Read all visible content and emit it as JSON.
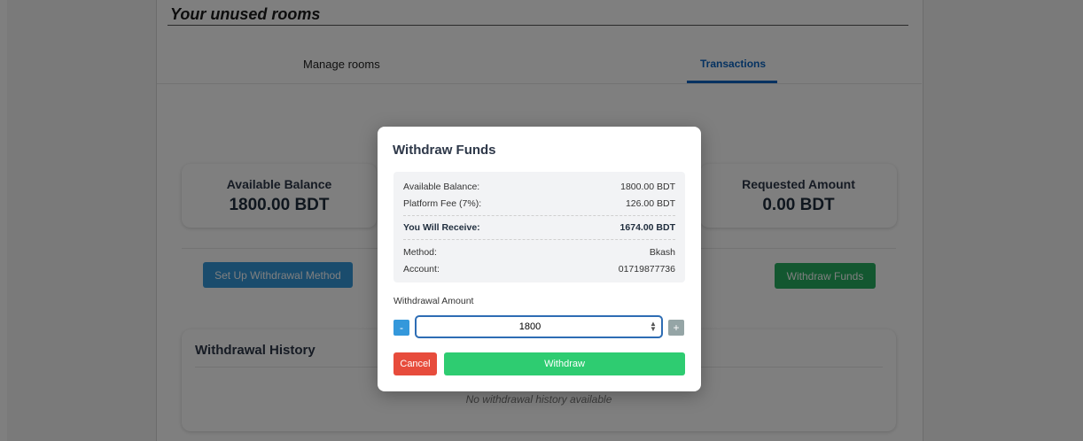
{
  "page": {
    "title": "Your unused rooms"
  },
  "tabs": [
    {
      "label": "Manage rooms"
    },
    {
      "label": "Transactions"
    }
  ],
  "balances": {
    "available_label": "Available Balance",
    "available_value": "1800.00 BDT",
    "requested_label": "Requested Amount",
    "requested_value": "0.00 BDT"
  },
  "actions": {
    "setup_label": "Set Up Withdrawal Method",
    "withdraw_label": "Withdraw Funds"
  },
  "history": {
    "title": "Withdrawal History",
    "empty_text": "No withdrawal history available"
  },
  "modal": {
    "title": "Withdraw Funds",
    "summary": {
      "available_key": "Available Balance:",
      "available_val": "1800.00 BDT",
      "fee_key": "Platform Fee (7%):",
      "fee_val": "126.00 BDT",
      "receive_key": "You Will Receive:",
      "receive_val": "1674.00 BDT",
      "method_key": "Method:",
      "method_val": "Bkash",
      "account_key": "Account:",
      "account_val": "01719877736"
    },
    "amount_label": "Withdrawal Amount",
    "amount_value": "1800",
    "minus": "-",
    "plus": "+",
    "cancel_label": "Cancel",
    "withdraw_label": "Withdraw"
  },
  "colors": {
    "primary": "#3498db",
    "success": "#2ecc71",
    "danger": "#e74c3c",
    "tab_active": "#0b65c2"
  }
}
